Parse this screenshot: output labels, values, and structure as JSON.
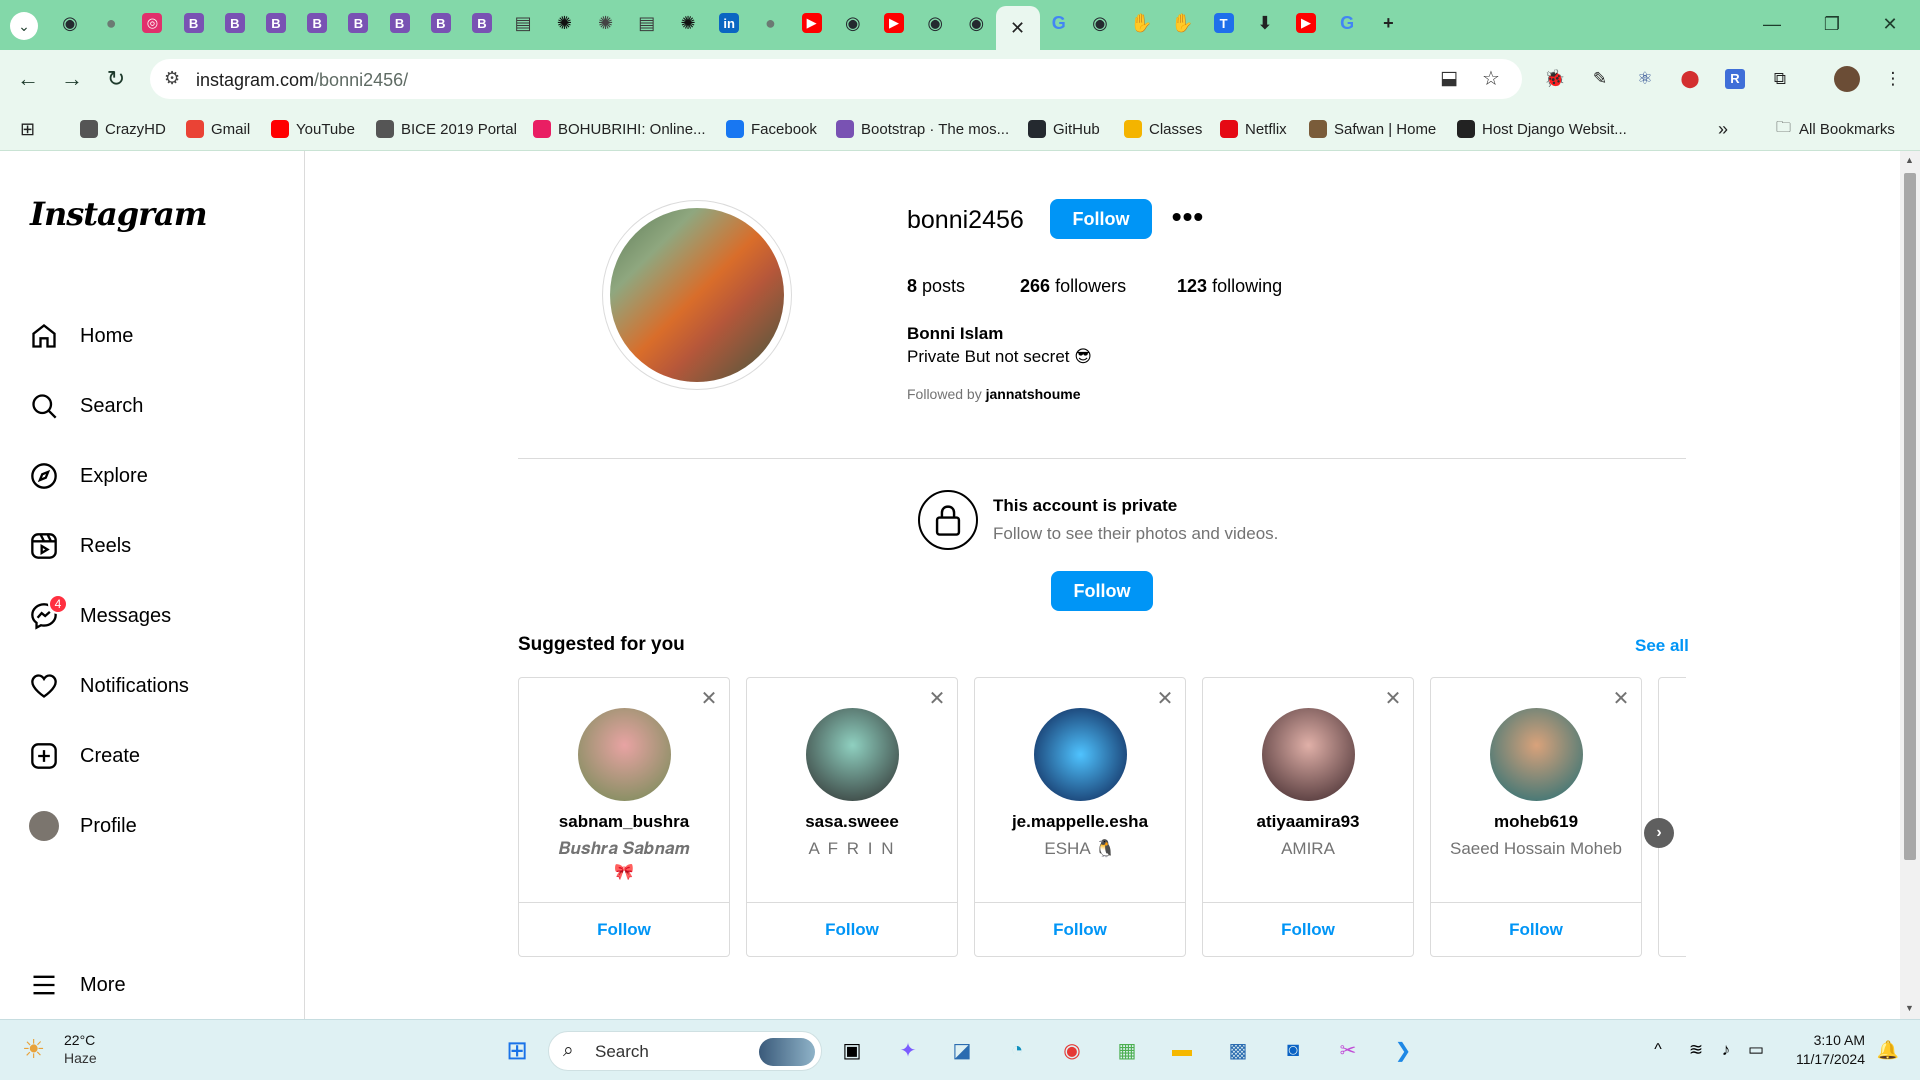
{
  "browser": {
    "tabs": [
      {
        "icon": "github-icon",
        "color": "#24292f",
        "glyph": "◉"
      },
      {
        "icon": "globe-icon",
        "color": "#6b7a73",
        "glyph": "●"
      },
      {
        "icon": "instagram-icon",
        "color": "#e1306c",
        "glyph": "◎"
      },
      {
        "icon": "bootstrap-icon",
        "color": "#7952b3",
        "glyph": "B"
      },
      {
        "icon": "bootstrap-icon",
        "color": "#7952b3",
        "glyph": "B"
      },
      {
        "icon": "bootstrap-icon",
        "color": "#7952b3",
        "glyph": "B"
      },
      {
        "icon": "bootstrap-icon",
        "color": "#7952b3",
        "glyph": "B"
      },
      {
        "icon": "bootstrap-icon",
        "color": "#7952b3",
        "glyph": "B"
      },
      {
        "icon": "bootstrap-icon",
        "color": "#7952b3",
        "glyph": "B"
      },
      {
        "icon": "bootstrap-icon",
        "color": "#7952b3",
        "glyph": "B"
      },
      {
        "icon": "bootstrap-icon",
        "color": "#7952b3",
        "glyph": "B"
      },
      {
        "icon": "book-icon",
        "color": "#3a3a3a",
        "glyph": "▤"
      },
      {
        "icon": "openai-icon",
        "color": "#111111",
        "glyph": "✺"
      },
      {
        "icon": "openai-icon",
        "color": "#444444",
        "glyph": "✺"
      },
      {
        "icon": "book-icon",
        "color": "#3a3a3a",
        "glyph": "▤"
      },
      {
        "icon": "openai-icon",
        "color": "#111111",
        "glyph": "✺"
      },
      {
        "icon": "linkedin-icon",
        "color": "#0a66c2",
        "glyph": "in"
      },
      {
        "icon": "globe-icon",
        "color": "#6b7a73",
        "glyph": "●"
      },
      {
        "icon": "youtube-icon",
        "color": "#ff0000",
        "glyph": "▶"
      },
      {
        "icon": "github-icon",
        "color": "#24292f",
        "glyph": "◉"
      },
      {
        "icon": "youtube-icon",
        "color": "#ff0000",
        "glyph": "▶"
      },
      {
        "icon": "github-icon",
        "color": "#24292f",
        "glyph": "◉"
      },
      {
        "icon": "github-icon",
        "color": "#24292f",
        "glyph": "◉"
      },
      {
        "icon": "close-icon",
        "color": "#222222",
        "glyph": "✕",
        "active": true
      },
      {
        "icon": "google-icon",
        "color": "#4285f4",
        "glyph": "G"
      },
      {
        "icon": "github-icon",
        "color": "#24292f",
        "glyph": "◉"
      },
      {
        "icon": "hand-icon",
        "color": "#2b6cb0",
        "glyph": "✋"
      },
      {
        "icon": "hand-icon",
        "color": "#2b6cb0",
        "glyph": "✋"
      },
      {
        "icon": "t-icon",
        "color": "#1f6feb",
        "glyph": "T"
      },
      {
        "icon": "download-icon",
        "color": "#222222",
        "glyph": "⬇"
      },
      {
        "icon": "youtube-icon",
        "color": "#ff0000",
        "glyph": "▶"
      },
      {
        "icon": "google-icon",
        "color": "#4285f4",
        "glyph": "G"
      },
      {
        "icon": "new-tab-icon",
        "color": "#222222",
        "glyph": "+"
      }
    ],
    "url_host": "instagram.com",
    "url_path": "/bonni2456/",
    "bookmarks": [
      {
        "label": "CrazyHD",
        "icon": "globe-icon",
        "color": "#555555"
      },
      {
        "label": "Gmail",
        "icon": "gmail-icon",
        "color": "#ea4335"
      },
      {
        "label": "YouTube",
        "icon": "youtube-icon",
        "color": "#ff0000"
      },
      {
        "label": "BICE 2019 Portal",
        "icon": "globe-icon",
        "color": "#555555"
      },
      {
        "label": "BOHUBRIHI: Online...",
        "icon": "bohubrihi-icon",
        "color": "#e91e63"
      },
      {
        "label": "Facebook",
        "icon": "facebook-icon",
        "color": "#1877f2"
      },
      {
        "label": "Bootstrap · The mos...",
        "icon": "bootstrap-icon",
        "color": "#7952b3"
      },
      {
        "label": "GitHub",
        "icon": "github-icon",
        "color": "#24292f"
      },
      {
        "label": "Classes",
        "icon": "classroom-icon",
        "color": "#f4b400"
      },
      {
        "label": "Netflix",
        "icon": "netflix-icon",
        "color": "#e50914"
      },
      {
        "label": "Safwan | Home",
        "icon": "avatar-icon",
        "color": "#7a5c3a"
      },
      {
        "label": "Host Django Websit...",
        "icon": "site-icon",
        "color": "#222222"
      }
    ],
    "all_bookmarks": "All Bookmarks"
  },
  "sidebar": {
    "logo": "Instagram",
    "items": [
      {
        "label": "Home",
        "icon": "home-icon"
      },
      {
        "label": "Search",
        "icon": "search-icon"
      },
      {
        "label": "Explore",
        "icon": "compass-icon"
      },
      {
        "label": "Reels",
        "icon": "reels-icon"
      },
      {
        "label": "Messages",
        "icon": "messenger-icon",
        "badge": "4"
      },
      {
        "label": "Notifications",
        "icon": "heart-icon"
      },
      {
        "label": "Create",
        "icon": "plus-square-icon"
      },
      {
        "label": "Profile",
        "icon": "avatar"
      }
    ],
    "more": "More"
  },
  "profile": {
    "username": "bonni2456",
    "follow_label": "Follow",
    "posts_count": "8",
    "posts_label": "posts",
    "followers_count": "266",
    "followers_label": "followers",
    "following_count": "123",
    "following_label": "following",
    "full_name": "Bonni Islam",
    "bio": "Private But not secret 😎",
    "followed_by_prefix": "Followed by",
    "followed_by_user": "jannatshoume"
  },
  "private": {
    "title": "This account is private",
    "subtitle": "Follow to see their photos and videos.",
    "follow_label": "Follow"
  },
  "suggestions": {
    "title": "Suggested for you",
    "see_all": "See all",
    "cards": [
      {
        "username": "sabnam_bushra",
        "subtitle": "𝑩𝒖𝒔𝒉𝒓𝒂 𝑺𝒂𝒃𝒏𝒂𝒎",
        "subtitle2": "🎀",
        "follow": "Follow",
        "avatar_color": "#c97b7b"
      },
      {
        "username": "sasa.sweee",
        "subtitle": "A F R I N",
        "subtitle2": "",
        "follow": "Follow",
        "avatar_color": "#3d4a44"
      },
      {
        "username": "je.mappelle.esha",
        "subtitle": "ESHA 🐧",
        "subtitle2": "",
        "follow": "Follow",
        "avatar_color": "#1c3f9e"
      },
      {
        "username": "atiyaamira93",
        "subtitle": "AMIRA",
        "subtitle2": "",
        "follow": "Follow",
        "avatar_color": "#7a4a4f"
      },
      {
        "username": "moheb619",
        "subtitle": "Saeed Hossain Moheb",
        "subtitle2": "",
        "follow": "Follow",
        "avatar_color": "#2f6f6a"
      }
    ]
  },
  "taskbar": {
    "temperature": "22°C",
    "condition": "Haze",
    "search_label": "Search",
    "time": "3:10 AM",
    "date": "11/17/2024"
  }
}
